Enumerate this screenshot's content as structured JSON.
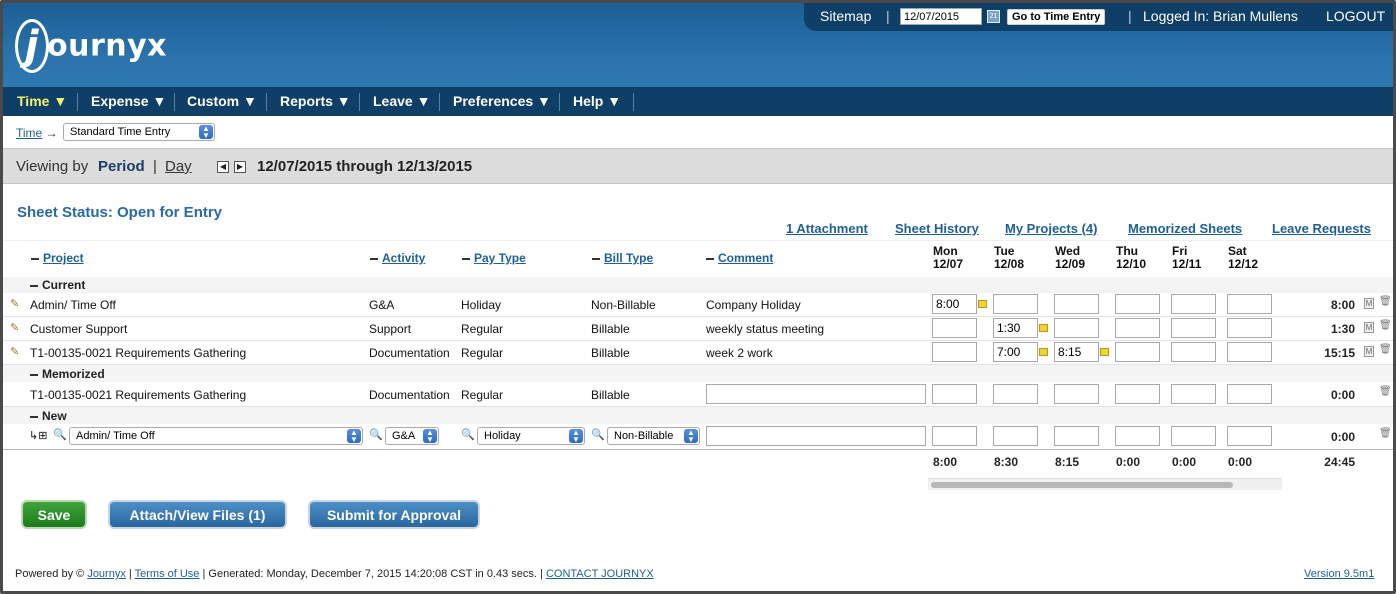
{
  "brand": {
    "logo_j": "j",
    "logo_rest": "ournyx"
  },
  "topbar": {
    "sitemap": "Sitemap",
    "sep": "|",
    "date_value": "12/07/2015",
    "goto_label": "Go to Time Entry",
    "logged_in": "Logged In: Brian Mullens",
    "logout": "LOGOUT"
  },
  "nav": {
    "items": [
      "Time ▼",
      "Expense ▼",
      "Custom ▼",
      "Reports ▼",
      "Leave ▼",
      "Preferences ▼",
      "Help ▼"
    ]
  },
  "breadcrumb": {
    "root": "Time",
    "arrow": "→",
    "selected": "Standard Time Entry"
  },
  "viewing": {
    "prefix": "Viewing by",
    "period": "Period",
    "sep": "|",
    "day": "Day",
    "range": "12/07/2015 through 12/13/2015"
  },
  "sheet": {
    "status": "Sheet Status: Open for Entry"
  },
  "links": [
    "1 Attachment",
    "Sheet History",
    "My Projects (4)",
    "Memorized Sheets",
    "Leave Requests"
  ],
  "columns": {
    "project": "Project",
    "activity": "Activity",
    "pay_type": "Pay Type",
    "bill_type": "Bill Type",
    "comment": "Comment"
  },
  "days": [
    {
      "dow": "Mon",
      "date": "12/07"
    },
    {
      "dow": "Tue",
      "date": "12/08"
    },
    {
      "dow": "Wed",
      "date": "12/09"
    },
    {
      "dow": "Thu",
      "date": "12/10"
    },
    {
      "dow": "Fri",
      "date": "12/11"
    },
    {
      "dow": "Sat",
      "date": "12/12"
    }
  ],
  "sections": {
    "current": "Current",
    "memorized": "Memorized",
    "new": "New"
  },
  "current_rows": [
    {
      "project": "Admin/ Time Off",
      "activity": "G&A",
      "pay": "Holiday",
      "bill": "Non-Billable",
      "comment": "Company Holiday",
      "hours": [
        "8:00",
        "",
        "",
        "",
        "",
        ""
      ],
      "total": "8:00"
    },
    {
      "project": "Customer Support",
      "activity": "Support",
      "pay": "Regular",
      "bill": "Billable",
      "comment": "weekly status meeting",
      "hours": [
        "",
        "1:30",
        "",
        "",
        "",
        ""
      ],
      "total": "1:30"
    },
    {
      "project": "T1-00135-0021 Requirements Gathering",
      "activity": "Documentation",
      "pay": "Regular",
      "bill": "Billable",
      "comment": "week 2 work",
      "hours": [
        "",
        "7:00",
        "8:15",
        "",
        "",
        ""
      ],
      "total": "15:15"
    }
  ],
  "memorized_row": {
    "project": "T1-00135-0021 Requirements Gathering",
    "activity": "Documentation",
    "pay": "Regular",
    "bill": "Billable",
    "total": "0:00"
  },
  "new_row": {
    "project": "Admin/ Time Off",
    "activity": "G&A",
    "pay": "Holiday",
    "bill": "Non-Billable",
    "total": "0:00"
  },
  "row_buttons": {
    "memorize": "M"
  },
  "column_totals": [
    "8:00",
    "8:30",
    "8:15",
    "0:00",
    "0:00",
    "0:00"
  ],
  "grand_total": "24:45",
  "buttons": {
    "save": "Save",
    "attach": "Attach/View Files (1)",
    "submit": "Submit for Approval"
  },
  "footer": {
    "powered": "Powered by ©",
    "journyx": "Journyx",
    "sep1": "|",
    "terms": "Terms of Use",
    "generated": "| Generated: Monday, December 7, 2015 14:20:08 CST in 0.43 secs. |",
    "contact": "CONTACT JOURNYX",
    "version": "Version 9.5m1"
  }
}
